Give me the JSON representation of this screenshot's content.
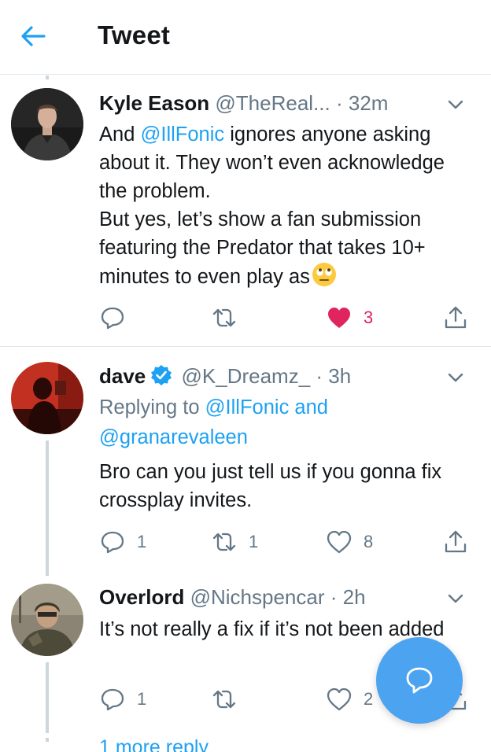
{
  "header": {
    "title": "Tweet"
  },
  "tweets": [
    {
      "name": "Kyle Eason",
      "handle": "@TheReal...",
      "time": "32m",
      "text_before": "And ",
      "mention": "@IllFonic",
      "text_after": " ignores anyone asking about it. They won’t even acknowledge the problem.\nBut yes, let’s show a fan submission featuring the Predator that takes 10+ minutes to even play as",
      "emoji": "face-with-rolling-eyes",
      "replies": "",
      "retweets": "",
      "likes": "3",
      "liked": true
    },
    {
      "name": "dave",
      "verified": true,
      "handle": "@K_Dreamz_",
      "time": "3h",
      "replying_prefix": "Replying to ",
      "replying_mentions": "@IllFonic and",
      "replying_mentions_2": "@granarevaleen",
      "text": "Bro can you just tell us if you gonna fix crossplay invites.",
      "replies": "1",
      "retweets": "1",
      "likes": "8"
    },
    {
      "name": "Overlord",
      "handle": "@Nichspencar",
      "time": "2h",
      "text": "It’s not really a fix if it’s not been added",
      "replies": "1",
      "retweets": "",
      "likes": "2"
    }
  ],
  "more_replies": "1 more reply",
  "colors": {
    "accent": "#1da1f2",
    "like": "#e0245e",
    "muted": "#657786",
    "fab": "#4ca3ef"
  },
  "icons": [
    "back-arrow-icon",
    "chevron-down-icon",
    "reply-icon",
    "retweet-icon",
    "heart-icon",
    "share-icon",
    "verified-badge-icon",
    "compose-reply-icon"
  ]
}
